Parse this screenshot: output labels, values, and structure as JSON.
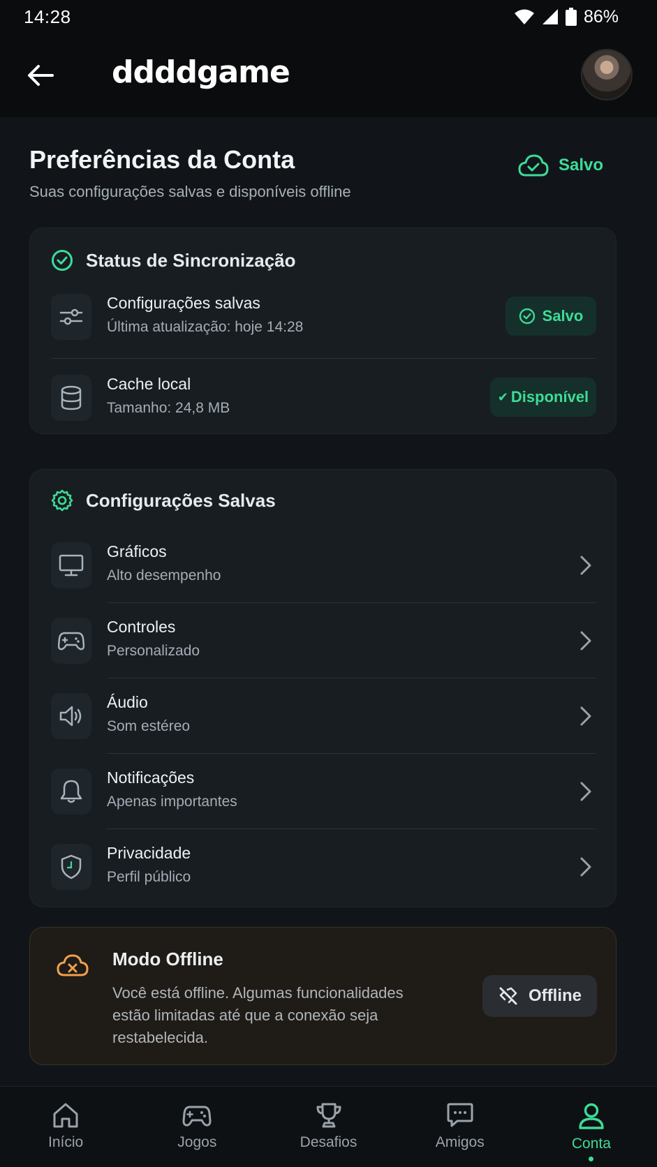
{
  "status_bar": {
    "time": "14:28",
    "battery": "86%"
  },
  "app": {
    "title": "ddddgame"
  },
  "page": {
    "title": "Preferências da Conta",
    "subtitle": "Suas configurações salvas e disponíveis offline",
    "saved_label": "Salvo"
  },
  "sync": {
    "heading": "Status de Sincronização",
    "rows": [
      {
        "title": "Configurações salvas",
        "detail": "Última atualização: hoje 14:28",
        "badge": "Salvo"
      },
      {
        "title": "Cache local",
        "detail": "Tamanho: 24,8 MB",
        "badge": "Disponível"
      }
    ]
  },
  "settings": {
    "heading": "Configurações Salvas",
    "items": [
      {
        "title": "Gráficos",
        "detail": "Alto desempenho",
        "icon": "monitor-icon"
      },
      {
        "title": "Controles",
        "detail": "Personalizado",
        "icon": "gamepad-icon"
      },
      {
        "title": "Áudio",
        "detail": "Som estéreo",
        "icon": "speaker-icon"
      },
      {
        "title": "Notificações",
        "detail": "Apenas importantes",
        "icon": "bell-icon"
      },
      {
        "title": "Privacidade",
        "detail": "Perfil público",
        "icon": "shield-icon"
      }
    ]
  },
  "offline": {
    "title": "Modo Offline",
    "description": "Você está offline. Algumas funcionalidades estão limitadas até que a conexão seja restabelecida.",
    "button_label": "Offline"
  },
  "nav": {
    "items": [
      {
        "label": "Início",
        "icon": "home-icon"
      },
      {
        "label": "Jogos",
        "icon": "gamepad-icon"
      },
      {
        "label": "Desafios",
        "icon": "trophy-icon"
      },
      {
        "label": "Amigos",
        "icon": "chat-icon"
      },
      {
        "label": "Conta",
        "icon": "user-icon",
        "active": true
      }
    ]
  },
  "colors": {
    "accent": "#3ddc97",
    "warning": "#f0a050",
    "background": "#111519",
    "card": "#181d22"
  }
}
